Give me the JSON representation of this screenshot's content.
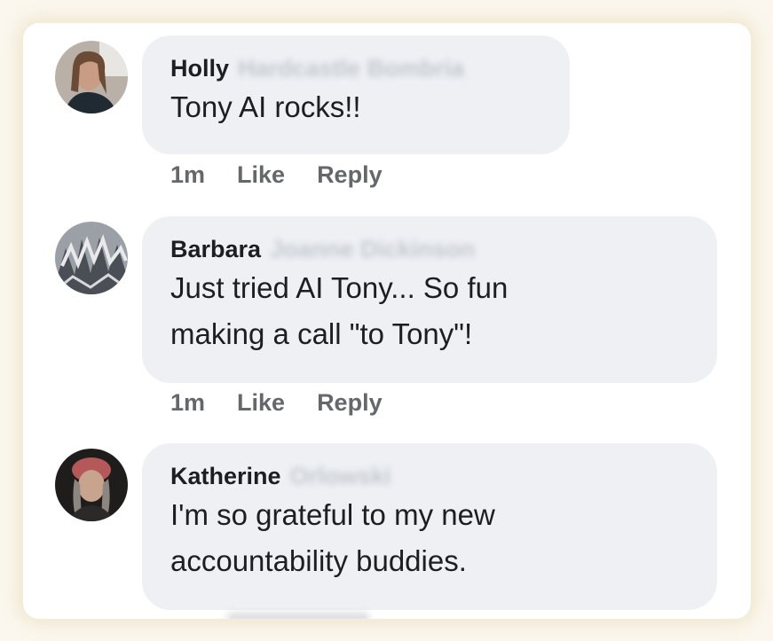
{
  "comments": [
    {
      "first_name": "Holly",
      "last_name": "Hardcastle Bombria",
      "text_lines": [
        "Tony AI rocks!!"
      ],
      "time": "1m",
      "like_label": "Like",
      "reply_label": "Reply"
    },
    {
      "first_name": "Barbara",
      "last_name": "Joanne Dickinson",
      "text_lines": [
        "Just tried AI Tony... So fun",
        "making a call \"to Tony\"!"
      ],
      "time": "1m",
      "like_label": "Like",
      "reply_label": "Reply"
    },
    {
      "first_name": "Katherine",
      "last_name": "Orlowski",
      "text_lines": [
        "I'm so grateful to my new",
        "accountability buddies."
      ]
    }
  ]
}
